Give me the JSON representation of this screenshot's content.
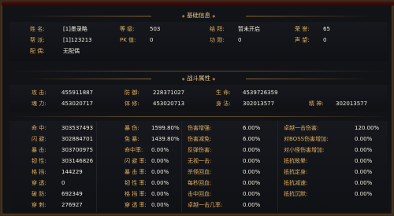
{
  "basic": {
    "title": "基础信息",
    "rows": [
      [
        {
          "label": "姓    名:",
          "value": "[1]墨录略"
        },
        {
          "label": "等    级:",
          "value": "503"
        },
        {
          "label": "结    拜:",
          "value": "暂未开启"
        },
        {
          "label": "荣    誉:",
          "value": "65"
        }
      ],
      [
        {
          "label": "帮    派:",
          "value": "[1]123213"
        },
        {
          "label": "PK    值:",
          "value": "0"
        },
        {
          "label": "功    勋:",
          "value": "0"
        },
        {
          "label": "声    望:",
          "value": "0"
        }
      ],
      [
        {
          "label": "配    偶:",
          "value": "无配偶"
        }
      ]
    ]
  },
  "combat": {
    "title": "战斗属性",
    "main_rows": [
      [
        {
          "label": "攻    击:",
          "value": "455911887"
        },
        {
          "label": "防    御:",
          "value": "228371027"
        },
        {
          "label": "生    命:",
          "value": "4539726359"
        }
      ],
      [
        {
          "label": "魂    力:",
          "value": "453020717"
        },
        {
          "label": "体    修:",
          "value": "453020713"
        },
        {
          "label": "身    法:",
          "value": "302013577"
        },
        {
          "label": "精    神:",
          "value": "302013577"
        }
      ]
    ],
    "detail_rows": [
      [
        {
          "label": "命    中:",
          "value": "303537493"
        },
        {
          "label": "暴    伤:",
          "value": "1599.80%"
        },
        {
          "label": "伤害增强:",
          "value": "6.00%"
        },
        {
          "label": "卓越一击伤害:",
          "value": "120.00%"
        }
      ],
      [
        {
          "label": "闪    避:",
          "value": "302884701"
        },
        {
          "label": "免    暴:",
          "value": "1439.80%"
        },
        {
          "label": "伤害减免:",
          "value": "6.00%"
        },
        {
          "label": "对BOSS伤害增加:",
          "value": "0.00%"
        }
      ],
      [
        {
          "label": "暴    击:",
          "value": "303700975"
        },
        {
          "label": "命中率:",
          "value": "0.00%"
        },
        {
          "label": "反弹伤害:",
          "value": "0.00%"
        },
        {
          "label": "对小怪伤害增加:",
          "value": "0.00%"
        }
      ],
      [
        {
          "label": "韧    性:",
          "value": "303146826"
        },
        {
          "label": "闪 避 率:",
          "value": "0.00%"
        },
        {
          "label": "无视一击:",
          "value": "0.00%"
        },
        {
          "label": "抵抗眩晕:",
          "value": "0.00%"
        }
      ],
      [
        {
          "label": "格    挡:",
          "value": "144229"
        },
        {
          "label": "暴 击 率:",
          "value": "0.00%"
        },
        {
          "label": "杀怪回血:",
          "value": "0.00%"
        },
        {
          "label": "抵抗定身:",
          "value": "0.00%"
        }
      ],
      [
        {
          "label": "穿    透:",
          "value": "0"
        },
        {
          "label": "韧 性 率:",
          "value": "0.00%"
        },
        {
          "label": "每秒回血:",
          "value": "0.00%"
        },
        {
          "label": "抵抗减速:",
          "value": "0.00%"
        }
      ],
      [
        {
          "label": "破    防:",
          "value": "692349"
        },
        {
          "label": "格 挡 率:",
          "value": "0.00%"
        },
        {
          "label": "击中回血:",
          "value": "0.00%"
        },
        {
          "label": "抵抗沉默:",
          "value": "0.00%"
        }
      ],
      [
        {
          "label": "穿    刺:",
          "value": "276927"
        },
        {
          "label": "穿 透 率:",
          "value": "0.00%"
        },
        {
          "label": "卓越一击几率:",
          "value": "0.00%"
        },
        {
          "label": "",
          "value": ""
        }
      ]
    ]
  }
}
